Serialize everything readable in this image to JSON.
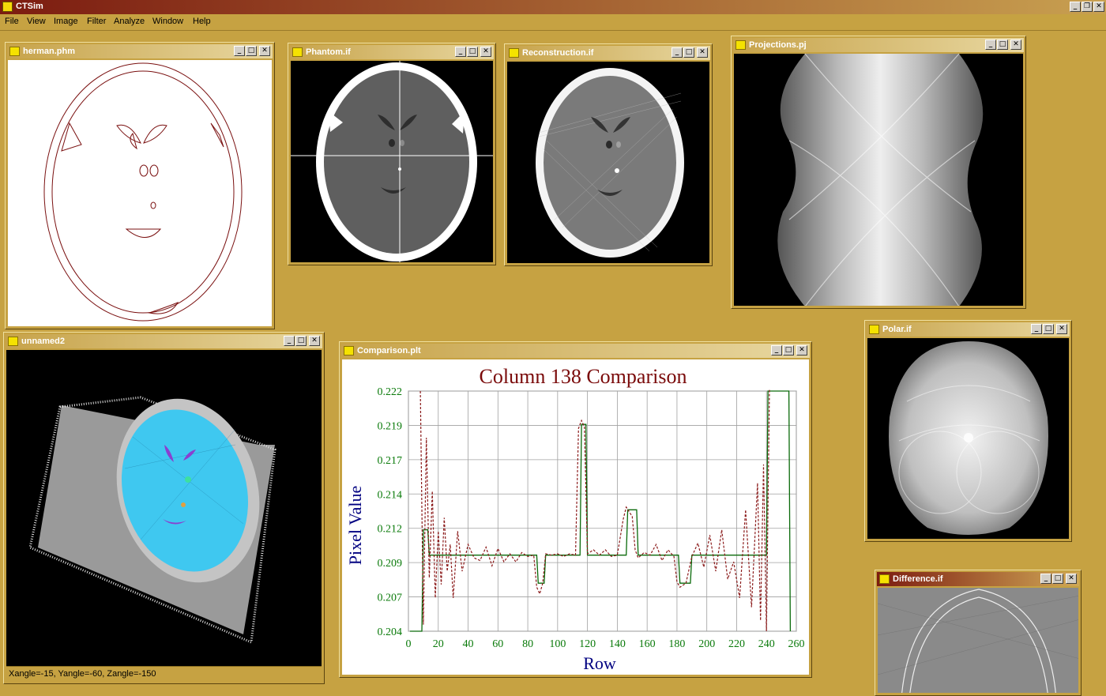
{
  "app": {
    "title": "CTSim"
  },
  "menu": [
    "File",
    "View",
    "Image",
    "Filter",
    "Analyze",
    "Window",
    "Help"
  ],
  "windows": {
    "herman": {
      "title": "herman.phm"
    },
    "phantom": {
      "title": "Phantom.if"
    },
    "recon": {
      "title": "Reconstruction.if"
    },
    "proj": {
      "title": "Projections.pj"
    },
    "unnamed": {
      "title": "unnamed2",
      "status": "Xangle=-15, Yangle=-60, Zangle=-150"
    },
    "comparison": {
      "title": "Comparison.plt"
    },
    "polar": {
      "title": "Polar.if"
    },
    "diff": {
      "title": "Difference.if"
    }
  },
  "chart_data": {
    "type": "line",
    "title": "Column 138 Comparison",
    "xlabel": "Row",
    "ylabel": "Pixel Value",
    "xlim": [
      0,
      260
    ],
    "ylim": [
      0.204,
      0.222
    ],
    "xticks": [
      "0",
      "20",
      "40",
      "60",
      "80",
      "100",
      "120",
      "140",
      "160",
      "180",
      "200",
      "220",
      "240",
      "260"
    ],
    "yticks": [
      "0.204",
      "0.207",
      "0.209",
      "0.212",
      "0.214",
      "0.217",
      "0.219",
      "0.222"
    ],
    "series": [
      {
        "style": "solid-green",
        "x": [
          1,
          9,
          10,
          13,
          14,
          86,
          87,
          91,
          92,
          115,
          116,
          119,
          120,
          146,
          147,
          153,
          154,
          181,
          182,
          189,
          190,
          240,
          241,
          243,
          255,
          256
        ],
        "y": [
          0.204,
          0.204,
          0.2116,
          0.2116,
          0.2097,
          0.2097,
          0.2076,
          0.2076,
          0.2097,
          0.2097,
          0.2195,
          0.2195,
          0.2097,
          0.2097,
          0.2131,
          0.2131,
          0.2097,
          0.2097,
          0.2076,
          0.2076,
          0.2097,
          0.2097,
          0.222,
          0.222,
          0.222,
          0.204
        ]
      },
      {
        "style": "dotted-red",
        "x": [
          8,
          10,
          12,
          14,
          16,
          18,
          20,
          22,
          24,
          26,
          28,
          30,
          33,
          36,
          40,
          44,
          48,
          52,
          56,
          60,
          64,
          68,
          72,
          76,
          80,
          84,
          86,
          88,
          90,
          92,
          96,
          100,
          104,
          108,
          112,
          114,
          116,
          118,
          120,
          124,
          128,
          132,
          136,
          140,
          144,
          146,
          150,
          152,
          154,
          158,
          162,
          166,
          170,
          174,
          178,
          180,
          182,
          186,
          190,
          194,
          198,
          202,
          206,
          210,
          214,
          218,
          222,
          226,
          230,
          234,
          236,
          238,
          240,
          242
        ],
        "y": [
          0.222,
          0.2045,
          0.2185,
          0.208,
          0.2145,
          0.2065,
          0.2115,
          0.2075,
          0.2125,
          0.2085,
          0.2105,
          0.2065,
          0.2115,
          0.2085,
          0.2105,
          0.2095,
          0.2093,
          0.2103,
          0.2089,
          0.2102,
          0.2092,
          0.2098,
          0.2092,
          0.2099,
          0.2096,
          0.2097,
          0.2073,
          0.2068,
          0.2076,
          0.2098,
          0.2097,
          0.2098,
          0.2096,
          0.2098,
          0.2097,
          0.2192,
          0.2198,
          0.2193,
          0.2098,
          0.2101,
          0.2097,
          0.2101,
          0.2096,
          0.2097,
          0.2124,
          0.2133,
          0.2126,
          0.2101,
          0.2095,
          0.2099,
          0.2097,
          0.2105,
          0.2093,
          0.2101,
          0.2096,
          0.2077,
          0.2073,
          0.2076,
          0.2096,
          0.2106,
          0.2088,
          0.2112,
          0.2085,
          0.2116,
          0.2079,
          0.2092,
          0.2065,
          0.2131,
          0.2058,
          0.2151,
          0.2048,
          0.2165,
          0.204,
          0.2222
        ]
      }
    ]
  }
}
